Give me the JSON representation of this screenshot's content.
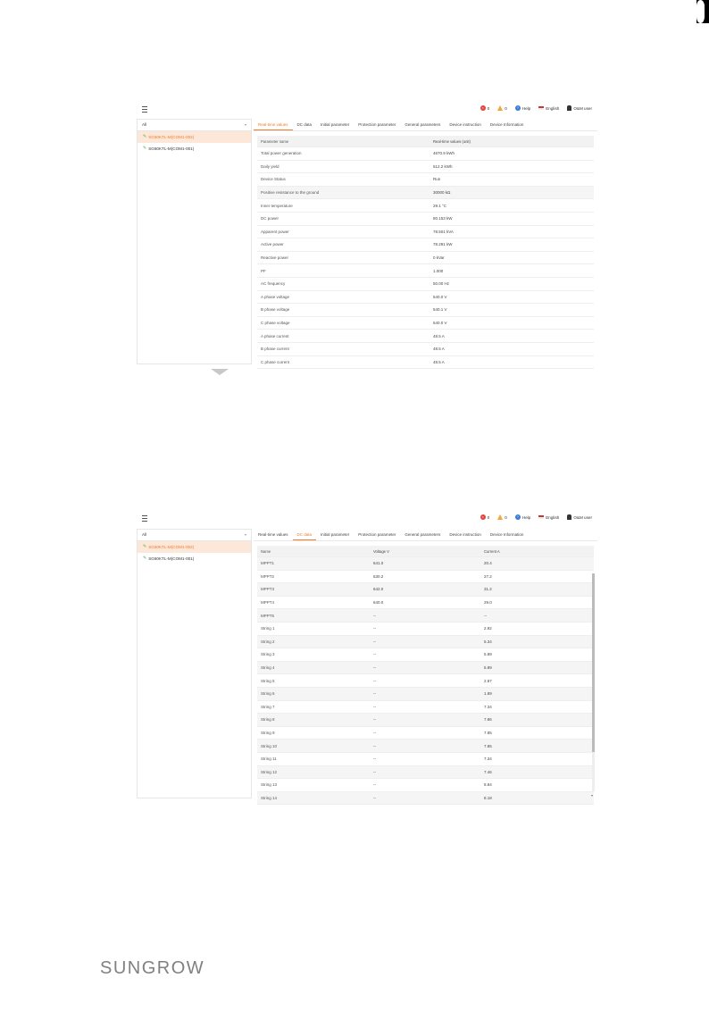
{
  "header": {
    "alarm_count": "0",
    "warning_count": "0",
    "help": "Help",
    "language": "English",
    "user": "O&M user"
  },
  "sidebar": {
    "filter": "All",
    "devices": [
      "SG60KTL-M(COM1-002)",
      "SG60KTL-M(COM1-001)"
    ]
  },
  "tabs": [
    "Real-time values",
    "DC data",
    "Initial parameter",
    "Protection parameter",
    "General parameters",
    "Device instruction",
    "Device Information"
  ],
  "screen1": {
    "headers": [
      "Parameter name",
      "Real-time values (unit)"
    ],
    "rows": [
      [
        "Total power generation",
        "4670.9 kWh"
      ],
      [
        "Daily yield",
        "512.2 kWh"
      ],
      [
        "Device Status",
        "Run"
      ],
      [
        "Positive resistance to the ground",
        "30000 kΩ"
      ],
      [
        "Inner temperature",
        "29.1 °C"
      ],
      [
        "DC power",
        "80.153 kW"
      ],
      [
        "Apparent power",
        "78.501 kVA"
      ],
      [
        "Active power",
        "78.291 kW"
      ],
      [
        "Reactive power",
        "0 kVar"
      ],
      [
        "PF",
        "1.000"
      ],
      [
        "AC frequency",
        "50.00 Hz"
      ],
      [
        "A phase voltage",
        "540.0 V"
      ],
      [
        "B phase voltage",
        "540.1 V"
      ],
      [
        "C phase voltage",
        "540.0 V"
      ],
      [
        "A phase current",
        "48.5 A"
      ],
      [
        "B phase current",
        "48.5 A"
      ],
      [
        "C phase current",
        "48.5 A"
      ]
    ]
  },
  "screen2": {
    "headers": [
      "Name",
      "Voltage V",
      "Current A"
    ],
    "rows": [
      [
        "MPPT1",
        "641.0",
        "20.4"
      ],
      [
        "MPPT2",
        "630.2",
        "27.2"
      ],
      [
        "MPPT3",
        "642.0",
        "31.2"
      ],
      [
        "MPPT4",
        "640.0",
        "29.0"
      ],
      [
        "MPPT5",
        "--",
        "--"
      ],
      [
        "String 1",
        "--",
        "2.92"
      ],
      [
        "String 2",
        "--",
        "5.34"
      ],
      [
        "String 3",
        "--",
        "5.89"
      ],
      [
        "String 4",
        "--",
        "5.89"
      ],
      [
        "String 5",
        "--",
        "2.87"
      ],
      [
        "String 6",
        "--",
        "1.89"
      ],
      [
        "String 7",
        "--",
        "7.34"
      ],
      [
        "String 8",
        "--",
        "7.86"
      ],
      [
        "String 9",
        "--",
        "7.85"
      ],
      [
        "String 10",
        "--",
        "7.85"
      ],
      [
        "String 11",
        "--",
        "7.34"
      ],
      [
        "String 12",
        "--",
        "7.46"
      ],
      [
        "String 13",
        "--",
        "8.84"
      ],
      [
        "String 14",
        "--",
        "8.18"
      ]
    ]
  },
  "footer": {
    "logo": "SUNGROW"
  },
  "colors": {
    "accent": "#f07c2c",
    "active_bg": "#fde7d9",
    "alarm": "#e0453e",
    "warning": "#f3a53a",
    "help": "#3a7bd5",
    "logo": "#808080"
  }
}
